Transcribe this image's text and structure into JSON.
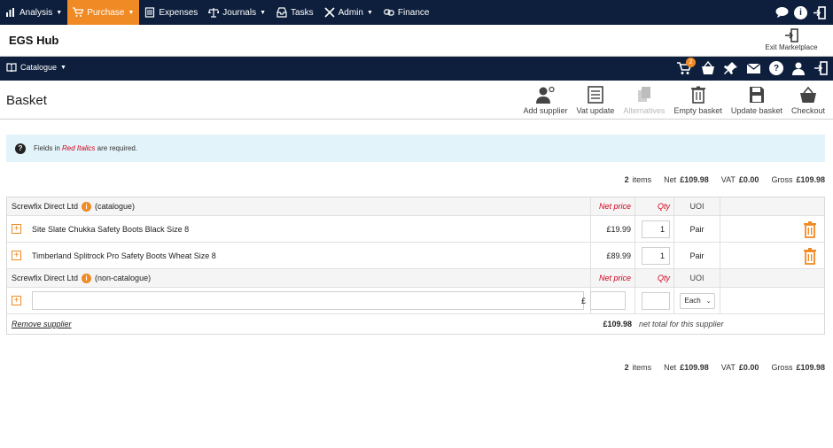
{
  "topnav": {
    "items": [
      {
        "label": "Analysis",
        "icon": "bar-chart-icon",
        "caret": true
      },
      {
        "label": "Purchase",
        "icon": "cart-icon",
        "caret": true,
        "active": true
      },
      {
        "label": "Expenses",
        "icon": "receipt-icon",
        "caret": false
      },
      {
        "label": "Journals",
        "icon": "scales-icon",
        "caret": true
      },
      {
        "label": "Tasks",
        "icon": "inbox-icon",
        "caret": false
      },
      {
        "label": "Admin",
        "icon": "tools-icon",
        "caret": true
      },
      {
        "label": "Finance",
        "icon": "link-icon",
        "caret": false
      }
    ]
  },
  "hub": {
    "title": "EGS Hub",
    "exit_label": "Exit Marketplace"
  },
  "catbar": {
    "catalogue_label": "Catalogue",
    "cart_count": "2"
  },
  "toolbar": {
    "page_title": "Basket",
    "tools": [
      {
        "label": "Add supplier",
        "icon": "add-user-icon",
        "disabled": false
      },
      {
        "label": "Vat update",
        "icon": "ledger-icon",
        "disabled": false
      },
      {
        "label": "Alternatives",
        "icon": "copy-icon",
        "disabled": true
      },
      {
        "label": "Empty basket",
        "icon": "trash-icon",
        "disabled": false
      },
      {
        "label": "Update basket",
        "icon": "save-icon",
        "disabled": false
      },
      {
        "label": "Checkout",
        "icon": "basket-icon",
        "disabled": false
      }
    ]
  },
  "notice": {
    "prefix": "Fields in",
    "highlight": "Red Italics",
    "suffix": "are required."
  },
  "summary": {
    "items_count": "2",
    "items_label": "items",
    "net_label": "Net",
    "net_value": "£109.98",
    "vat_label": "VAT",
    "vat_value": "£0.00",
    "gross_label": "Gross",
    "gross_value": "£109.98"
  },
  "basket": {
    "catalogue_group": {
      "supplier": "Screwfix Direct Ltd",
      "type": "(catalogue)",
      "net_price_header": "Net price",
      "qty_header": "Qty",
      "uoi_header": "UOI",
      "rows": [
        {
          "description": "Site Slate Chukka Safety Boots Black Size 8",
          "price": "£19.99",
          "qty": "1",
          "uoi": "Pair"
        },
        {
          "description": "Timberland Splitrock Pro Safety Boots Wheat Size 8",
          "price": "£89.99",
          "qty": "1",
          "uoi": "Pair"
        }
      ]
    },
    "noncat_group": {
      "supplier": "Screwfix Direct Ltd",
      "type": "(non-catalogue)",
      "net_price_header": "Net price",
      "qty_header": "Qty",
      "uoi_header": "UOI",
      "currency": "£",
      "uoi_selected": "Each"
    },
    "footer": {
      "remove_label": "Remove supplier",
      "total": "£109.98",
      "note": "net total for this supplier"
    }
  },
  "colors": {
    "nav_bg": "#0d1f3c",
    "accent": "#f08a24",
    "required": "#d0021b",
    "notice_bg": "#e3f3fa"
  }
}
